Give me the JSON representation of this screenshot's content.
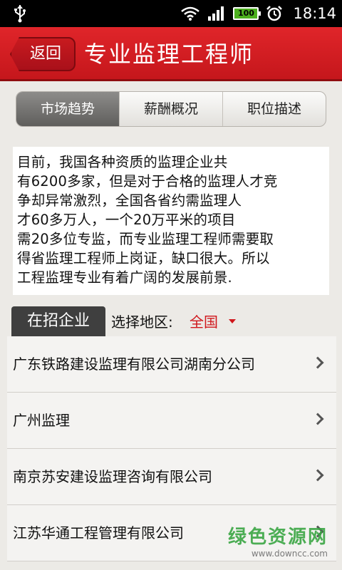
{
  "status_bar": {
    "battery": "100",
    "time": "18:14"
  },
  "header": {
    "back_label": "返回",
    "title": "专业监理工程师"
  },
  "tabs": [
    {
      "label": "市场趋势",
      "active": true
    },
    {
      "label": "薪酬概况",
      "active": false
    },
    {
      "label": "职位描述",
      "active": false
    }
  ],
  "description_lines": [
    "目前，我国各种资质的监理企业共",
    "有6200多家，但是对于合格的监理人才竞",
    "争却异常激烈，全国各省约需监理人",
    "才60多万人，一个20万平米的项目",
    "需20多位专监，而专业监理工程师需要取",
    "得省监理工程师上岗证，缺口很大。所以",
    "工程监理专业有着广阔的发展前景."
  ],
  "section": {
    "tab_label": "在招企业",
    "region_label": "选择地区:",
    "region_value": "全国"
  },
  "companies": [
    "广东铁路建设监理有限公司湖南分公司",
    "广州监理",
    "南京苏安建设监理咨询有限公司",
    "江苏华通工程管理有限公司"
  ],
  "watermark": {
    "main": "绿色资源网",
    "sub": "www.downcc.com"
  },
  "colors": {
    "title_red": "#d41e23",
    "accent_red": "#d0161b",
    "tab_active": "#6f6e6c",
    "section_tab": "#3f3f3f",
    "watermark_green": "#3aa644"
  }
}
